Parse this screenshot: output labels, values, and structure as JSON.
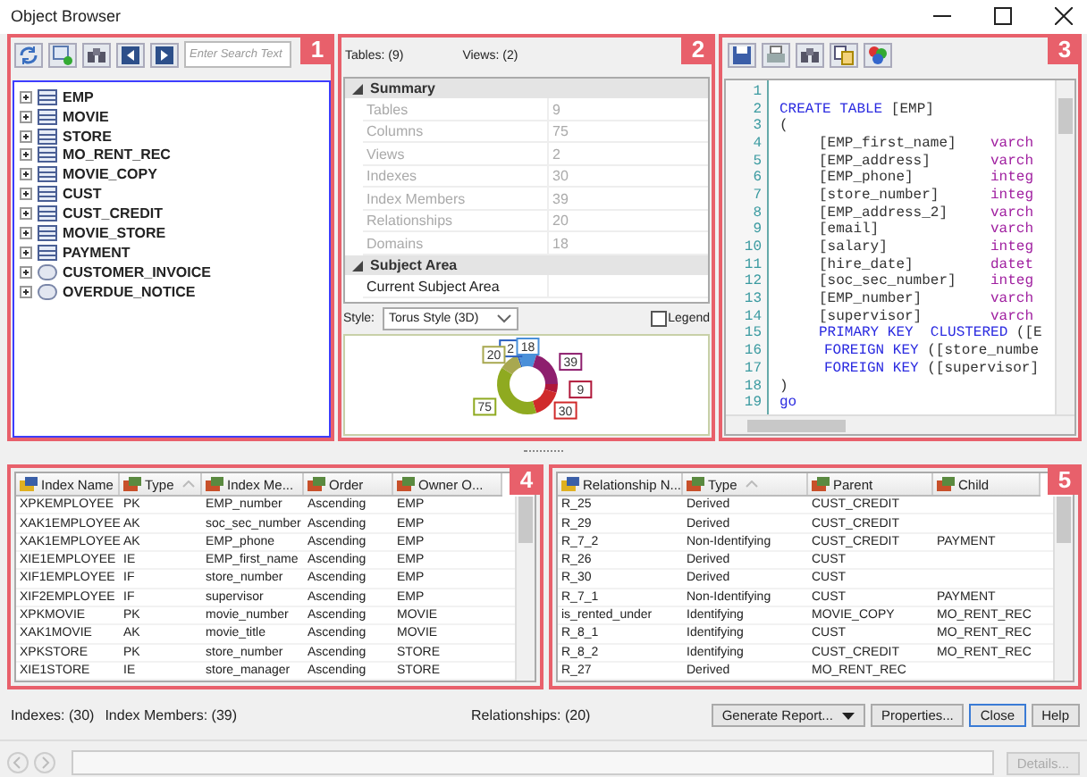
{
  "window": {
    "title": "Object Browser"
  },
  "panels": {
    "tree": {
      "badge": "1",
      "search": {
        "placeholder": "Enter Search Text"
      },
      "items": [
        {
          "label": "EMP",
          "kind": "table",
          "expanded": false
        },
        {
          "label": "MOVIE",
          "kind": "table",
          "expanded": false
        },
        {
          "label": "STORE",
          "kind": "table",
          "expanded": false
        },
        {
          "label": "MO_RENT_REC",
          "kind": "table",
          "expanded": false
        },
        {
          "label": "MOVIE_COPY",
          "kind": "table",
          "expanded": false
        },
        {
          "label": "CUST",
          "kind": "table",
          "expanded": false
        },
        {
          "label": "CUST_CREDIT",
          "kind": "table",
          "expanded": false
        },
        {
          "label": "MOVIE_STORE",
          "kind": "table",
          "expanded": false
        },
        {
          "label": "PAYMENT",
          "kind": "table",
          "expanded": false
        },
        {
          "label": "CUSTOMER_INVOICE",
          "kind": "view",
          "expanded": false
        },
        {
          "label": "OVERDUE_NOTICE",
          "kind": "view",
          "expanded": false
        }
      ]
    },
    "summary": {
      "badge": "2",
      "tables_count": "Tables: (9)",
      "views_count": "Views: (2)",
      "sections": [
        {
          "title": "Summary",
          "expanded": true,
          "rows": [
            {
              "label": "Tables",
              "value": "9",
              "disabled": true
            },
            {
              "label": "Columns",
              "value": "75",
              "disabled": true
            },
            {
              "label": "Views",
              "value": "2",
              "disabled": true
            },
            {
              "label": "Indexes",
              "value": "30",
              "disabled": true
            },
            {
              "label": "Index Members",
              "value": "39",
              "disabled": true
            },
            {
              "label": "Relationships",
              "value": "20",
              "disabled": true
            },
            {
              "label": "Domains",
              "value": "18",
              "disabled": true
            }
          ]
        },
        {
          "title": "Subject Area",
          "expanded": true,
          "rows": [
            {
              "label": "Current Subject Area",
              "disabled": false
            }
          ]
        }
      ],
      "style_label": "Style:",
      "style_value": "Torus Style (3D)",
      "legend": {
        "label": "Legend",
        "checked": false
      },
      "chart_data": {
        "type": "donut",
        "values": [
          2,
          18,
          39,
          9,
          30,
          75,
          20
        ],
        "colors": [
          "#2a5fbf",
          "#4a90d9",
          "#8e1f6e",
          "#b0183a",
          "#d02a2a",
          "#8faa20",
          "#a8a850"
        ],
        "data_labels": true
      }
    },
    "code": {
      "badge": "3",
      "lines": [
        {
          "num": "1",
          "kind": "blank"
        },
        {
          "num": "2",
          "kind": "statement",
          "keyword": "CREATE TABLE",
          "rest": " [EMP]"
        },
        {
          "num": "3",
          "kind": "paren",
          "rest": "("
        },
        {
          "num": "4",
          "kind": "column",
          "name": "[EMP_first_name]",
          "type": "varch"
        },
        {
          "num": "5",
          "kind": "column",
          "name": "[EMP_address]",
          "type": "varch"
        },
        {
          "num": "6",
          "kind": "column",
          "name": "[EMP_phone]",
          "type": "integ"
        },
        {
          "num": "7",
          "kind": "column",
          "name": "[store_number]",
          "type": "integ"
        },
        {
          "num": "8",
          "kind": "column",
          "name": "[EMP_address_2]",
          "type": "varch"
        },
        {
          "num": "9",
          "kind": "column",
          "name": "[email]",
          "type": "varch"
        },
        {
          "num": "10",
          "kind": "column",
          "name": "[salary]",
          "type": "integ"
        },
        {
          "num": "11",
          "kind": "column",
          "name": "[hire_date]",
          "type": "datet"
        },
        {
          "num": "12",
          "kind": "column",
          "name": "[soc_sec_number]",
          "type": "integ"
        },
        {
          "num": "13",
          "kind": "column",
          "name": "[EMP_number]",
          "type": "varch"
        },
        {
          "num": "14",
          "kind": "column",
          "name": "[supervisor]",
          "type": "varch"
        },
        {
          "num": "15",
          "kind": "primary",
          "keyword": "PRIMARY KEY  CLUSTERED",
          "rest": " ([E"
        },
        {
          "num": "16",
          "kind": "foreign",
          "keyword": "FOREIGN KEY",
          "rest": " ([store_numbe"
        },
        {
          "num": "17",
          "kind": "foreign",
          "keyword": "FOREIGN KEY",
          "rest": " ([supervisor]"
        },
        {
          "num": "18",
          "kind": "paren",
          "rest": ")"
        },
        {
          "num": "19",
          "kind": "statement",
          "keyword": "go"
        }
      ]
    },
    "indexes": {
      "badge": "4",
      "columns": [
        {
          "label": "Index Name",
          "sorted": false
        },
        {
          "label": "Type",
          "sorted": true
        },
        {
          "label": "Index Me...",
          "sorted": false
        },
        {
          "label": "Order",
          "sorted": false
        },
        {
          "label": "Owner O...",
          "sorted": false
        }
      ],
      "rows": [
        [
          "XPKEMPLOYEE",
          "PK",
          "EMP_number",
          "Ascending",
          "EMP"
        ],
        [
          "XAK1EMPLOYEE",
          "AK",
          "soc_sec_number",
          "Ascending",
          "EMP"
        ],
        [
          "XAK1EMPLOYEE",
          "AK",
          "EMP_phone",
          "Ascending",
          "EMP"
        ],
        [
          "XIE1EMPLOYEE",
          "IE",
          "EMP_first_name",
          "Ascending",
          "EMP"
        ],
        [
          "XIF1EMPLOYEE",
          "IF",
          "store_number",
          "Ascending",
          "EMP"
        ],
        [
          "XIF2EMPLOYEE",
          "IF",
          "supervisor",
          "Ascending",
          "EMP"
        ],
        [
          "XPKMOVIE",
          "PK",
          "movie_number",
          "Ascending",
          "MOVIE"
        ],
        [
          "XAK1MOVIE",
          "AK",
          "movie_title",
          "Ascending",
          "MOVIE"
        ],
        [
          "XPKSTORE",
          "PK",
          "store_number",
          "Ascending",
          "STORE"
        ],
        [
          "XIE1STORE",
          "IE",
          "store_manager",
          "Ascending",
          "STORE"
        ]
      ]
    },
    "relationships": {
      "badge": "5",
      "columns": [
        {
          "label": "Relationship N...",
          "sorted": false
        },
        {
          "label": "Type",
          "sorted": true
        },
        {
          "label": "Parent",
          "sorted": false
        },
        {
          "label": "Child",
          "sorted": false
        }
      ],
      "rows": [
        [
          "R_25",
          "Derived",
          "CUST_CREDIT",
          ""
        ],
        [
          "R_29",
          "Derived",
          "CUST_CREDIT",
          ""
        ],
        [
          "R_7_2",
          "Non-Identifying",
          "CUST_CREDIT",
          "PAYMENT"
        ],
        [
          "R_26",
          "Derived",
          "CUST",
          ""
        ],
        [
          "R_30",
          "Derived",
          "CUST",
          ""
        ],
        [
          "R_7_1",
          "Non-Identifying",
          "CUST",
          "PAYMENT"
        ],
        [
          "is_rented_under",
          "Identifying",
          "MOVIE_COPY",
          "MO_RENT_REC"
        ],
        [
          "R_8_1",
          "Identifying",
          "CUST",
          "MO_RENT_REC"
        ],
        [
          "R_8_2",
          "Identifying",
          "CUST_CREDIT",
          "MO_RENT_REC"
        ],
        [
          "R_27",
          "Derived",
          "MO_RENT_REC",
          ""
        ]
      ]
    }
  },
  "status": {
    "indexes": "Indexes: (30)",
    "index_members": "Index Members: (39)",
    "relationships": "Relationships: (20)"
  },
  "buttons": [
    {
      "label": "Generate Report...",
      "kind": "menu",
      "disabled": false,
      "default": false
    },
    {
      "label": "Properties...",
      "kind": "plain",
      "disabled": false,
      "default": false
    },
    {
      "label": "Close",
      "kind": "plain",
      "disabled": false,
      "default": true
    },
    {
      "label": "Help",
      "kind": "plain",
      "disabled": false,
      "default": false
    }
  ],
  "footer": {
    "back_disabled": true,
    "forward_disabled": true,
    "details": {
      "label": "Details...",
      "disabled": true
    }
  }
}
